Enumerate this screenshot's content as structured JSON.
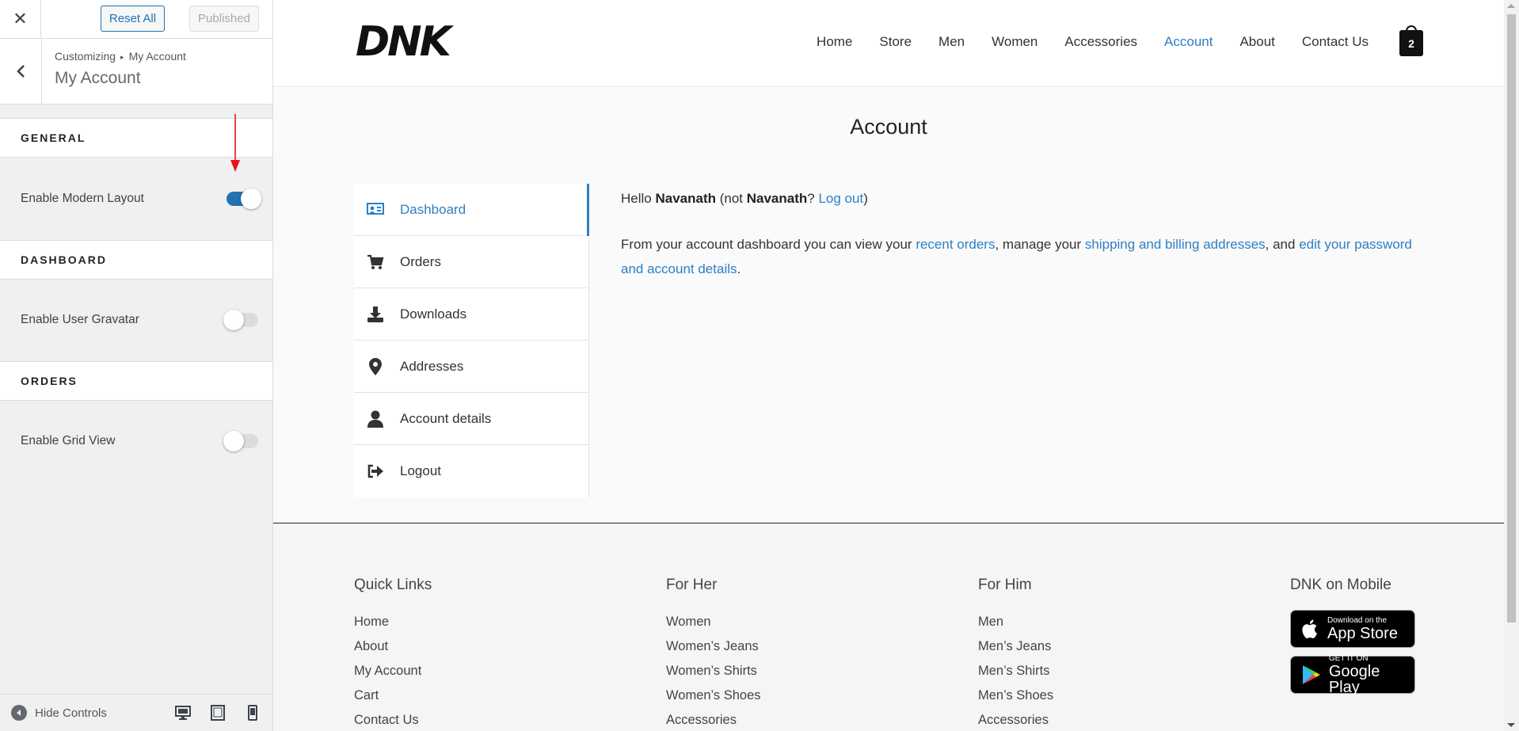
{
  "customizer": {
    "reset_label": "Reset All",
    "published_label": "Published",
    "breadcrumb_root": "Customizing",
    "breadcrumb_current": "My Account",
    "panel_title": "My Account",
    "sections": [
      {
        "title": "GENERAL",
        "setting": "Enable Modern Layout",
        "enabled": true
      },
      {
        "title": "DASHBOARD",
        "setting": "Enable User Gravatar",
        "enabled": false
      },
      {
        "title": "ORDERS",
        "setting": "Enable Grid View",
        "enabled": false
      }
    ],
    "hide_controls_label": "Hide Controls",
    "devices": [
      "desktop-icon",
      "tablet-icon",
      "mobile-icon"
    ]
  },
  "site": {
    "logo_text": "DNK",
    "nav": [
      "Home",
      "Store",
      "Men",
      "Women",
      "Accessories",
      "Account",
      "About",
      "Contact Us"
    ],
    "active_nav": "Account",
    "cart_count": "2",
    "accent_color": "#2e7fc4"
  },
  "account": {
    "page_title": "Account",
    "menu": [
      {
        "label": "Dashboard",
        "icon": "dashboard-icon",
        "active": true
      },
      {
        "label": "Orders",
        "icon": "cart-icon"
      },
      {
        "label": "Downloads",
        "icon": "download-icon"
      },
      {
        "label": "Addresses",
        "icon": "location-pin-icon"
      },
      {
        "label": "Account details",
        "icon": "user-icon"
      },
      {
        "label": "Logout",
        "icon": "sign-out-icon"
      }
    ],
    "greeting": {
      "hello": "Hello ",
      "name": "Navanath",
      "not": " (not ",
      "name2": "Navanath",
      "q": "? ",
      "logout_link": "Log out",
      "close": ")"
    },
    "intro": {
      "t1": "From your account dashboard you can view your ",
      "link1": "recent orders",
      "t2": ", manage your ",
      "link2": "shipping and billing addresses",
      "t3": ", and ",
      "link3": "edit your password and account details",
      "t4": "."
    }
  },
  "footer": {
    "quick_links": {
      "title": "Quick Links",
      "links": [
        "Home",
        "About",
        "My Account",
        "Cart",
        "Contact Us"
      ]
    },
    "for_her": {
      "title": "For Her",
      "links": [
        "Women",
        "Women’s Jeans",
        "Women’s Shirts",
        "Women’s Shoes",
        "Accessories"
      ]
    },
    "for_him": {
      "title": "For Him",
      "links": [
        "Men",
        "Men’s Jeans",
        "Men’s Shirts",
        "Men’s Shoes",
        "Accessories"
      ]
    },
    "mobile": {
      "title": "DNK on Mobile",
      "app_store_small": "Download on the",
      "app_store_big": "App Store",
      "google_small": "GET IT ON",
      "google_big": "Google Play"
    }
  }
}
